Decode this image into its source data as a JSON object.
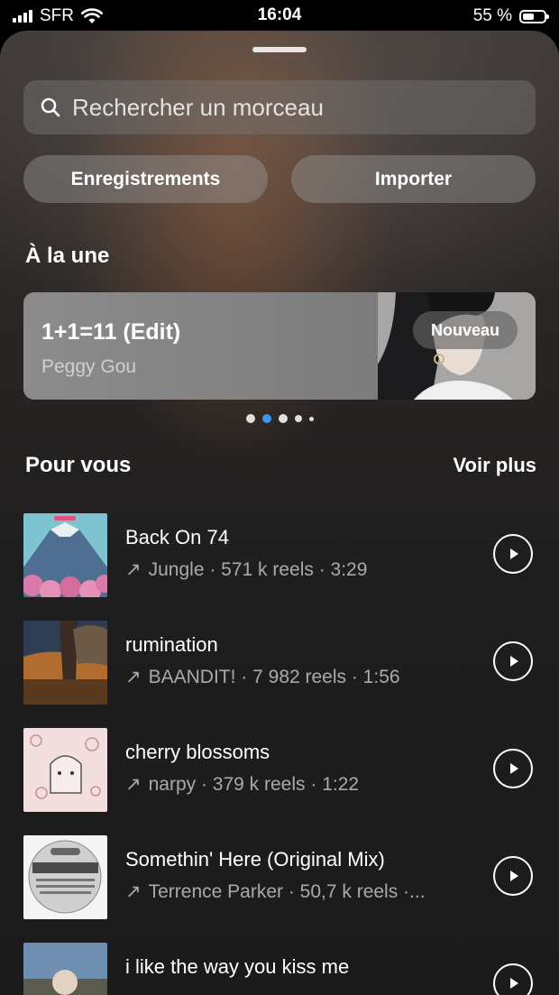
{
  "status_bar": {
    "carrier": "SFR",
    "time": "16:04",
    "battery": "55 %",
    "battery_level": 0.55
  },
  "search": {
    "placeholder": "Rechercher un morceau",
    "icon": "search-icon"
  },
  "buttons": {
    "recordings": "Enregistrements",
    "import": "Importer"
  },
  "featured": {
    "section_title": "À la une",
    "title": "1+1=11 (Edit)",
    "artist": "Peggy Gou",
    "badge": "Nouveau",
    "page_count": 5,
    "active_page": 1
  },
  "for_you": {
    "section_title": "Pour vous",
    "see_more": "Voir plus",
    "tracks": [
      {
        "title": "Back On 74",
        "meta": "Jungle · 571 k reels · 3:29"
      },
      {
        "title": "rumination",
        "meta": "BAANDIT! · 7 982 reels · 1:56"
      },
      {
        "title": "cherry blossoms",
        "meta": "narpy · 379 k reels · 1:22"
      },
      {
        "title": "Somethin' Here (Original Mix)",
        "meta": "Terrence Parker · 50,7 k reels ·..."
      },
      {
        "title": "i like the way you kiss me",
        "meta": ""
      }
    ]
  }
}
